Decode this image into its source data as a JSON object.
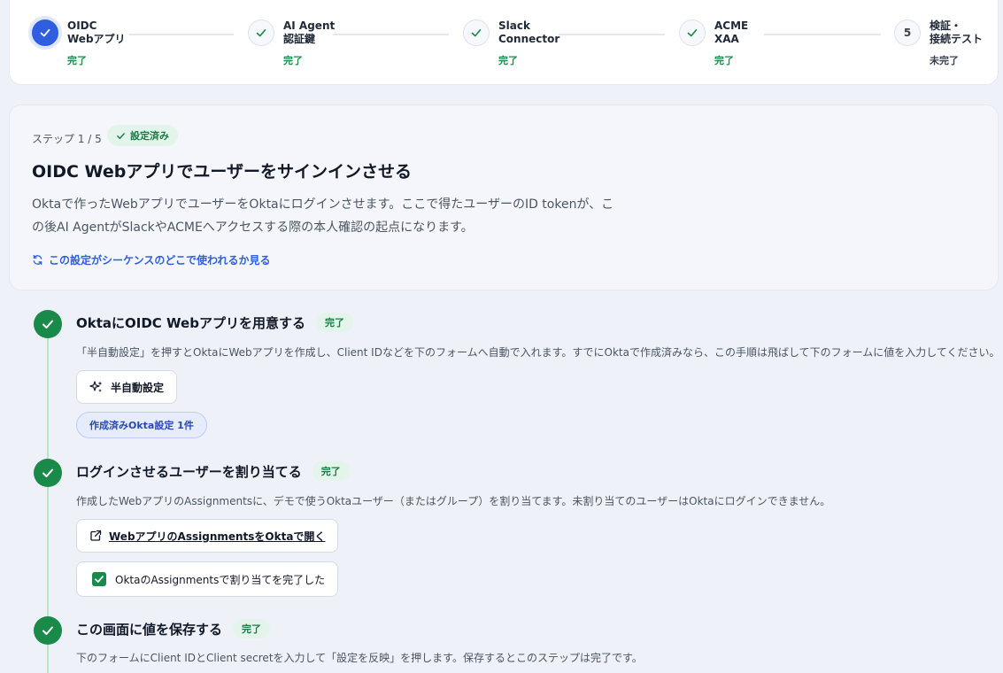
{
  "stepper": {
    "steps": [
      {
        "title": "OIDC\nWebアプリ",
        "status": "完了",
        "state": "active"
      },
      {
        "title": "AI Agent\n認証鍵",
        "status": "完了",
        "state": "done"
      },
      {
        "title": "Slack\nConnector",
        "status": "完了",
        "state": "done"
      },
      {
        "title": "ACME\nXAA",
        "status": "完了",
        "state": "done"
      },
      {
        "title": "検証・\n接続テスト",
        "status": "未完了",
        "state": "pending",
        "number": "5"
      }
    ]
  },
  "info": {
    "step_count": "ステップ 1 / 5",
    "badge": "設定済み",
    "title": "OIDC Webアプリでユーザーをサインインさせる",
    "description": "Oktaで作ったWebアプリでユーザーをOktaにログインさせます。ここで得たユーザーのID tokenが、この後AI AgentがSlackやACMEへアクセスする際の本人確認の起点になります。",
    "sequence_link": "この設定がシーケンスのどこで使われるか見る"
  },
  "tasks": [
    {
      "title": "OktaにOIDC Webアプリを用意する",
      "badge": "完了",
      "description": "「半自動設定」を押すとOktaにWebアプリを作成し、Client IDなどを下のフォームへ自動で入れます。すでにOktaで作成済みなら、この手順は飛ばして下のフォームに値を入力してください。",
      "button": "半自動設定",
      "pill": "作成済みOkta設定 1件"
    },
    {
      "title": "ログインさせるユーザーを割り当てる",
      "badge": "完了",
      "description": "作成したWebアプリのAssignmentsに、デモで使うOktaユーザー（またはグループ）を割り当てます。未割り当てのユーザーはOktaにログインできません。",
      "link_button": "WebアプリのAssignmentsをOktaで開く",
      "checkbox_label": "OktaのAssignmentsで割り当てを完了した",
      "checkbox_checked": true
    },
    {
      "title": "この画面に値を保存する",
      "badge": "完了",
      "description": "下のフォームにClient IDとClient secretを入力して「設定を反映」を押します。保存するとこのステップは完了です。"
    }
  ],
  "colors": {
    "accent": "#2f5fe0",
    "success": "#1a8a4a",
    "success_bg": "#e3f5ea",
    "page_bg": "#eef1f7"
  }
}
